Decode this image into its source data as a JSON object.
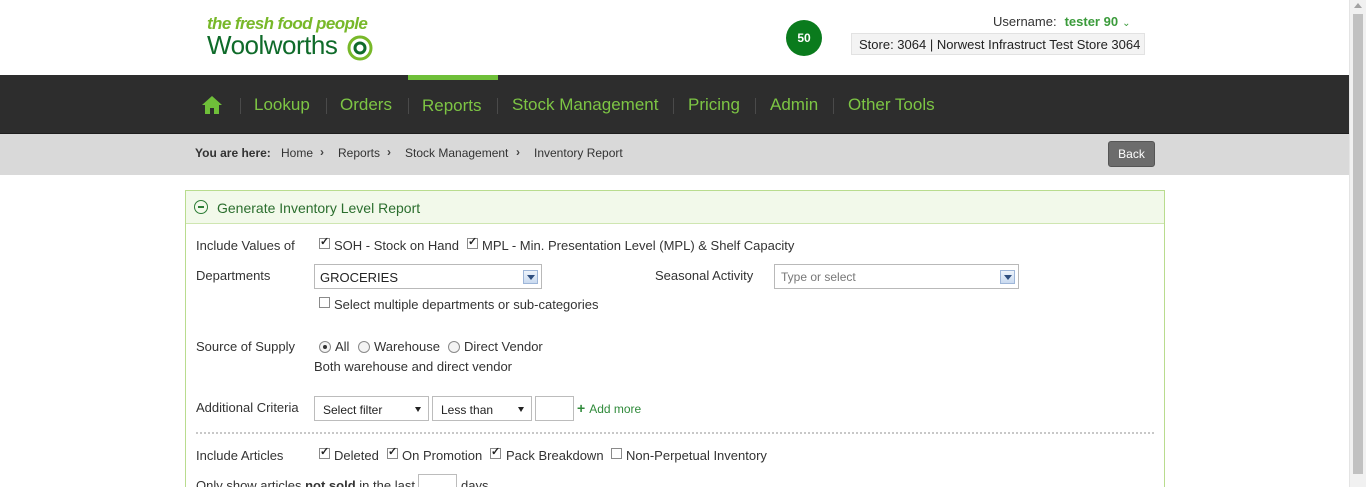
{
  "header": {
    "tagline": "the fresh food people",
    "brand": "Woolworths",
    "badge_count": "50",
    "username_label": "Username:",
    "username": "tester 90",
    "store": "Store: 3064 | Norwest Infrastruct Test Store 3064"
  },
  "nav": {
    "items": [
      {
        "label": "Lookup"
      },
      {
        "label": "Orders"
      },
      {
        "label": "Reports"
      },
      {
        "label": "Stock Management"
      },
      {
        "label": "Pricing"
      },
      {
        "label": "Admin"
      },
      {
        "label": "Other Tools"
      }
    ],
    "active": "Reports"
  },
  "breadcrumb": {
    "lead": "You are here:",
    "items": [
      "Home",
      "Reports",
      "Stock Management",
      "Inventory Report"
    ],
    "back_label": "Back"
  },
  "panel": {
    "title": "Generate Inventory Level Report",
    "include_values": {
      "label": "Include Values of",
      "options": [
        {
          "label": "SOH - Stock on Hand",
          "checked": true
        },
        {
          "label": "MPL - Min. Presentation Level (MPL) & Shelf Capacity",
          "checked": true
        }
      ]
    },
    "departments": {
      "label": "Departments",
      "value": "GROCERIES",
      "multi_label": "Select multiple departments or sub-categories",
      "multi_checked": false
    },
    "seasonal": {
      "label": "Seasonal Activity",
      "placeholder": "Type or select"
    },
    "source_of_supply": {
      "label": "Source of Supply",
      "options": [
        {
          "label": "All",
          "checked": true
        },
        {
          "label": "Warehouse",
          "checked": false
        },
        {
          "label": "Direct Vendor",
          "checked": false
        }
      ],
      "description": "Both warehouse and direct vendor"
    },
    "additional_criteria": {
      "label": "Additional Criteria",
      "filter": "Select filter",
      "operator": "Less than",
      "value": "",
      "add_more": "Add more"
    },
    "include_articles": {
      "label": "Include Articles",
      "options": [
        {
          "label": "Deleted",
          "checked": true
        },
        {
          "label": "On Promotion",
          "checked": true
        },
        {
          "label": "Pack Breakdown",
          "checked": true
        },
        {
          "label": "Non-Perpetual Inventory",
          "checked": false
        }
      ]
    },
    "not_sold": {
      "prefix": "Only show articles",
      "bold": "not sold",
      "middle": "in the last",
      "suffix": "days"
    }
  },
  "colors": {
    "brand_green": "#0f6b2a",
    "nav_green": "#7dc544",
    "nav_bg": "#2d2d2d",
    "badge_green": "#0a7b1d"
  }
}
